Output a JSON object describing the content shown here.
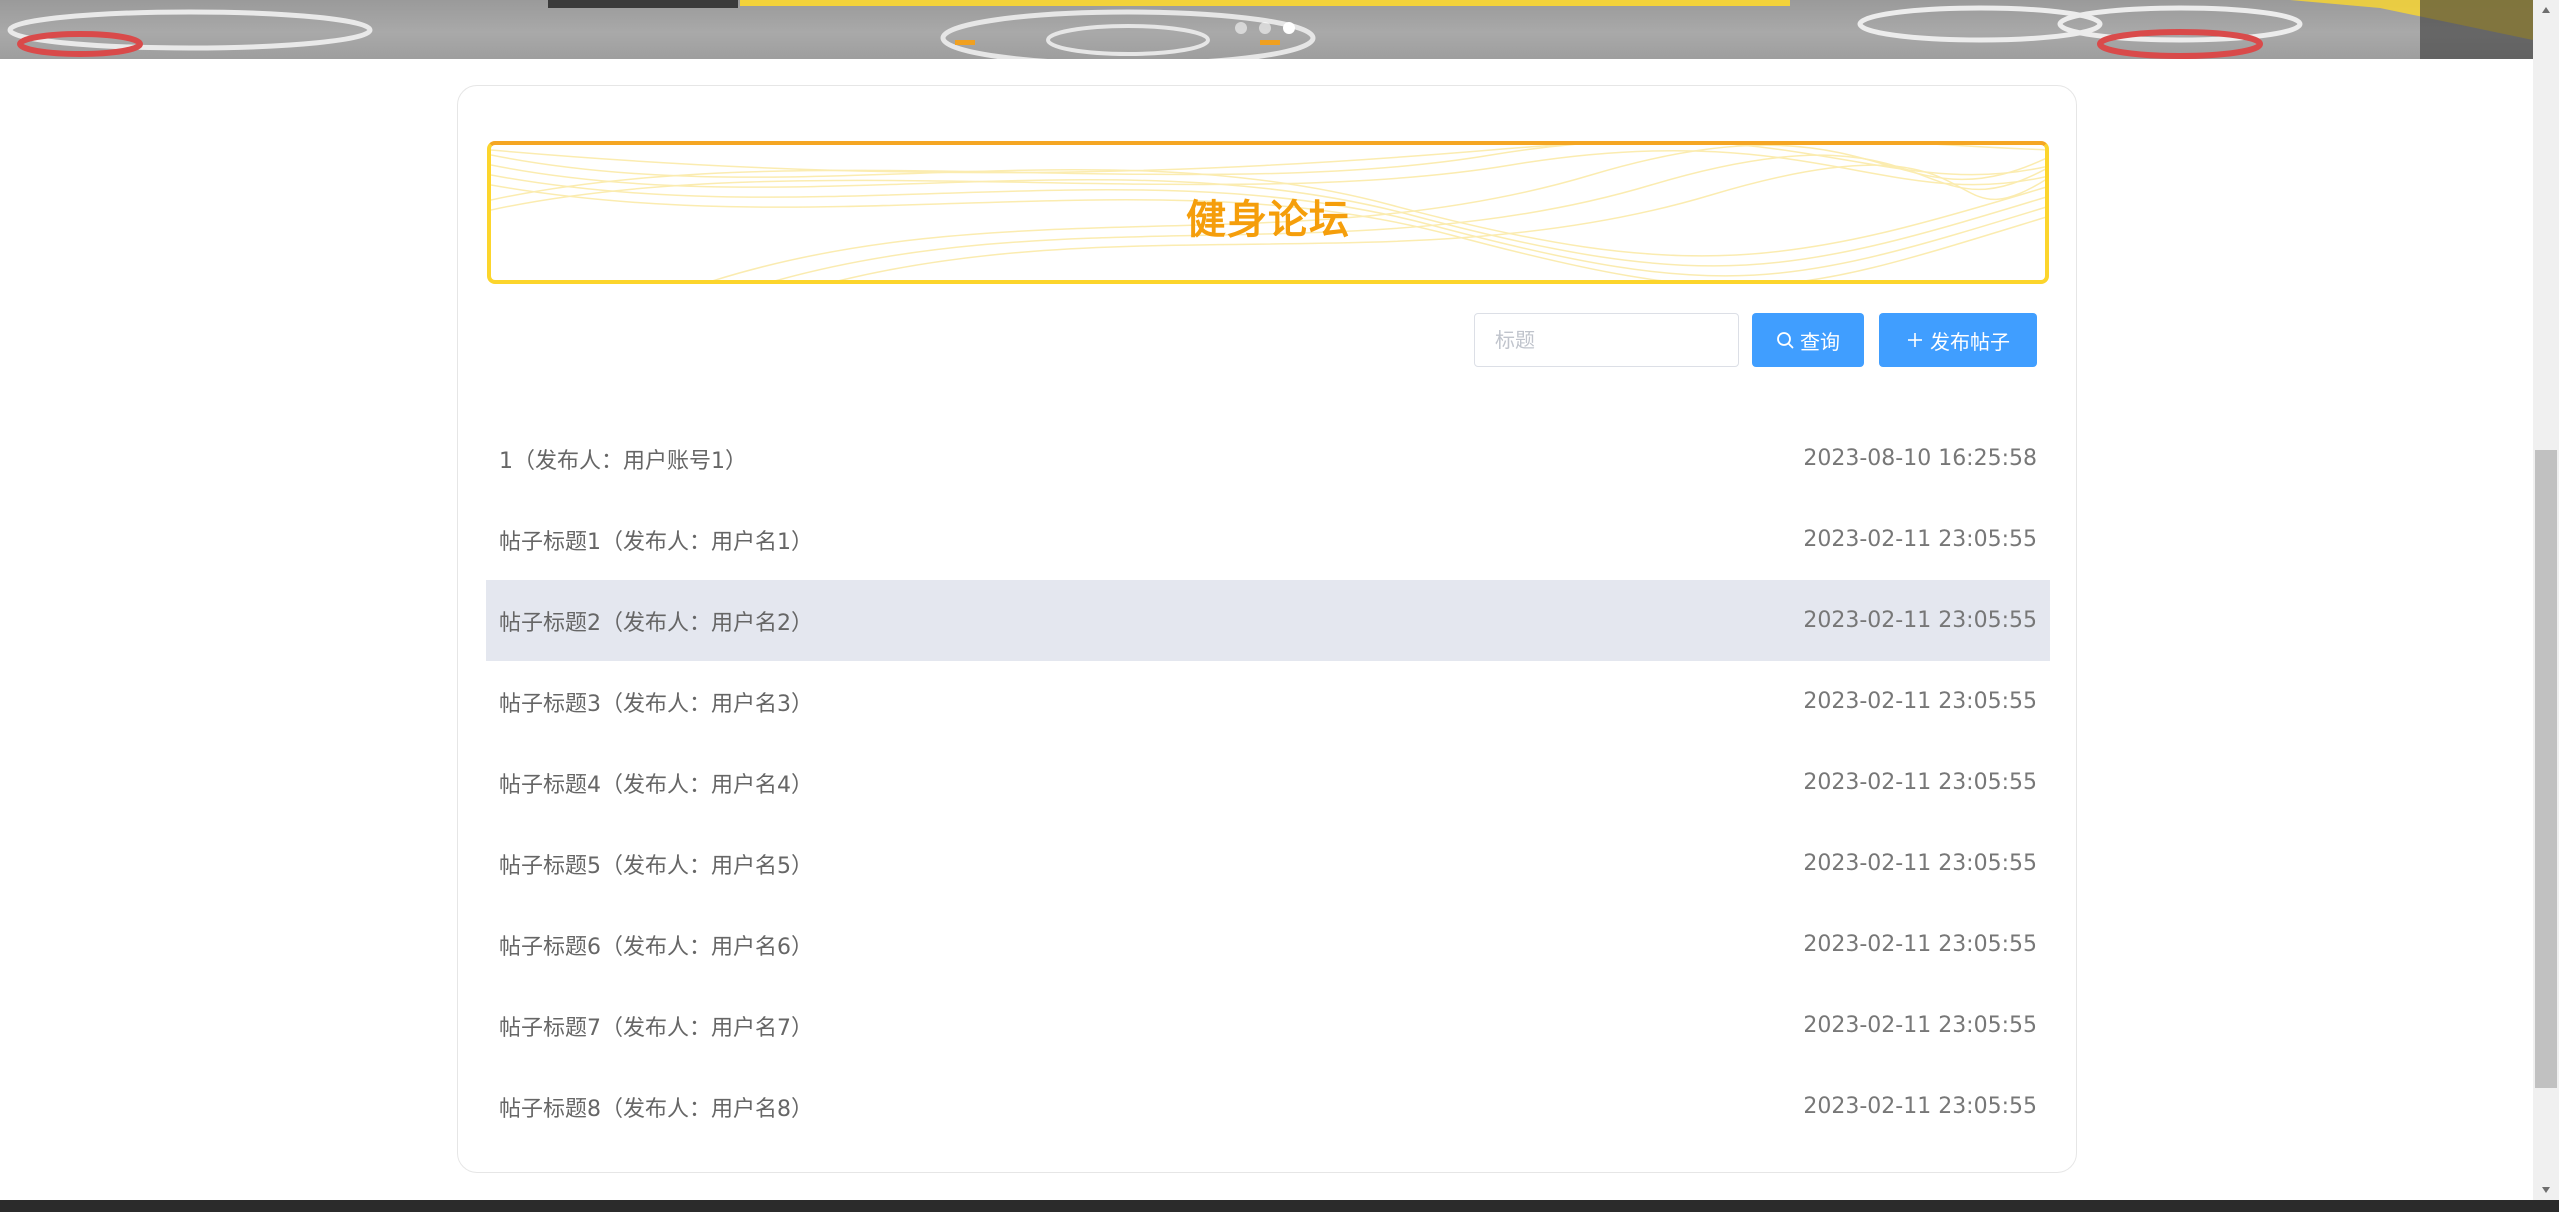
{
  "banner": {
    "carousel_dots": 3,
    "active_dot": 2
  },
  "forum": {
    "title": "健身论坛"
  },
  "search": {
    "placeholder": "标题",
    "value": ""
  },
  "buttons": {
    "query_label": "查询",
    "publish_label": "发布帖子"
  },
  "posts": [
    {
      "title": "1（发布人：用户账号1）",
      "time": "2023-08-10 16:25:58"
    },
    {
      "title": "帖子标题1（发布人：用户名1）",
      "time": "2023-02-11 23:05:55"
    },
    {
      "title": "帖子标题2（发布人：用户名2）",
      "time": "2023-02-11 23:05:55"
    },
    {
      "title": "帖子标题3（发布人：用户名3）",
      "time": "2023-02-11 23:05:55"
    },
    {
      "title": "帖子标题4（发布人：用户名4）",
      "time": "2023-02-11 23:05:55"
    },
    {
      "title": "帖子标题5（发布人：用户名5）",
      "time": "2023-02-11 23:05:55"
    },
    {
      "title": "帖子标题6（发布人：用户名6）",
      "time": "2023-02-11 23:05:55"
    },
    {
      "title": "帖子标题7（发布人：用户名7）",
      "time": "2023-02-11 23:05:55"
    },
    {
      "title": "帖子标题8（发布人：用户名8）",
      "time": "2023-02-11 23:05:55"
    }
  ],
  "colors": {
    "accent": "#409eff",
    "title": "#f59e0b",
    "header_border": "#fcd52c",
    "row_highlight": "#e4e7ef"
  },
  "icons": {
    "query": "search-icon",
    "publish": "plus-icon"
  }
}
